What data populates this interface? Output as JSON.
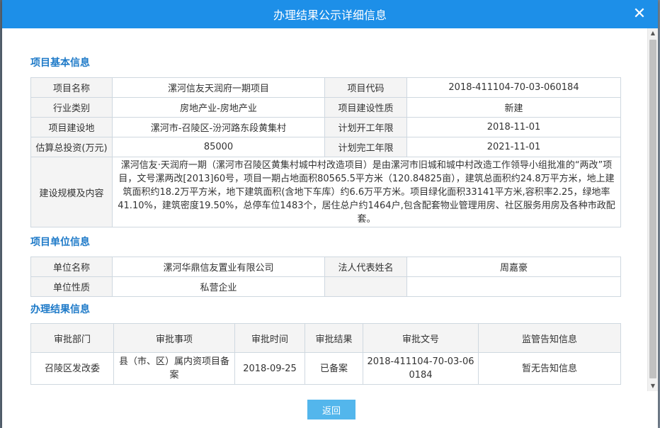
{
  "modal": {
    "title": "办理结果公示详细信息",
    "close_glyph": "✕",
    "back_label": "返回"
  },
  "basic": {
    "section_title": "项目基本信息",
    "rows": [
      [
        "项目名称",
        "漯河信友天润府一期项目",
        "项目代码",
        "2018-411104-70-03-060184"
      ],
      [
        "行业类别",
        "房地产业-房地产业",
        "项目建设性质",
        "新建"
      ],
      [
        "项目建设地",
        "漯河市-召陵区-汾河路东段黄集村",
        "计划开工年限",
        "2018-11-01"
      ],
      [
        "估算总投资(万元)",
        "85000",
        "计划完工年限",
        "2021-11-01"
      ]
    ],
    "scale_label": "建设规模及内容",
    "scale_text": "漯河信友·天润府一期（漯河市召陵区黄集村城中村改造项目）是由漯河市旧城和城中村改造工作领导小组批准的“两改”项目，文号漯两改[2013]60号，项目一期占地面积80565.5平方米（120.84825亩），建筑总面积约24.8万平方米，地上建筑面积约18.2万平方米，地下建筑面积(含地下车库）约6.6万平方米。项目绿化面积33141平方米,容积率2.25，绿地率41.10%，建筑密度19.50%，总停车位1483个，居住总户约1464户,包含配套物业管理用房、社区服务用房及各种市政配套。"
  },
  "unit": {
    "section_title": "项目单位信息",
    "rows": [
      [
        "单位名称",
        "漯河华鼎信友置业有限公司",
        "法人代表姓名",
        "周嘉豪"
      ],
      [
        "单位性质",
        "私营企业",
        "",
        ""
      ]
    ]
  },
  "result": {
    "section_title": "办理结果信息",
    "headers": [
      "审批部门",
      "审批事项",
      "审批时间",
      "审批结果",
      "审批文号",
      "监管告知信息"
    ],
    "row": [
      "召陵区发改委",
      "县（市、区）属内资项目备案",
      "2018-09-25",
      "已备案",
      "2018-411104-70-03-060184",
      "暂无告知信息"
    ]
  },
  "scrollbar": {
    "up_glyph": "▲",
    "down_glyph": "▼"
  }
}
